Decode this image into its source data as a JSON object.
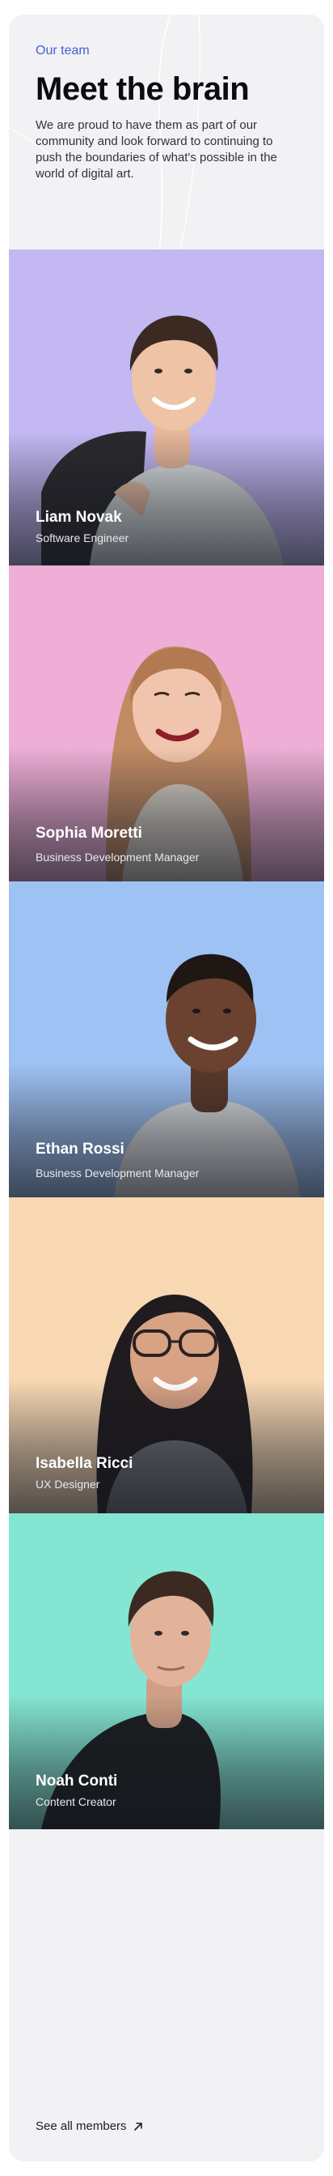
{
  "header": {
    "eyebrow": "Our team",
    "title": "Meet the brain",
    "intro": "We are proud to have them as part of our community and look forward to continuing to push the boundaries of what's possible in the world of digital art."
  },
  "members": [
    {
      "name": "Liam Novak",
      "role": "Software Engineer",
      "bg_color": "#c3b8f2"
    },
    {
      "name": "Sophia Moretti",
      "role": "Business Development Manager",
      "bg_color": "#eeaed6"
    },
    {
      "name": "Ethan Rossi",
      "role": "Business Development Manager",
      "bg_color": "#9fc2f4"
    },
    {
      "name": "Isabella Ricci",
      "role": "UX Designer",
      "bg_color": "#f7d8b3"
    },
    {
      "name": "Noah Conti",
      "role": "Content Creator",
      "bg_color": "#84e6d2"
    }
  ],
  "footer": {
    "link_label": "See all members",
    "link_icon": "arrow-up-right-icon"
  },
  "colors": {
    "accent": "#3f63d8",
    "card_bg": "#f2f2f4",
    "text_dark": "#0b0b12"
  }
}
